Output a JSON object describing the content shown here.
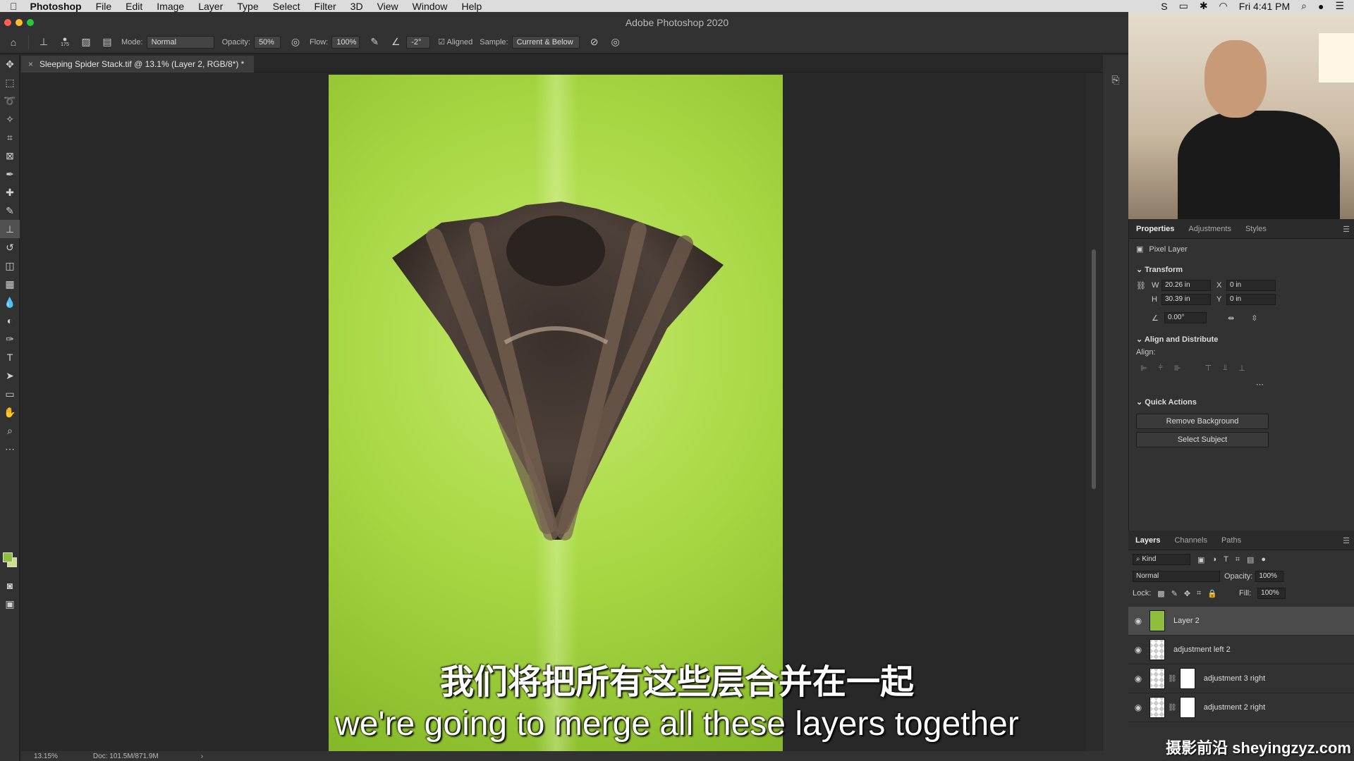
{
  "menubar": {
    "app": "Photoshop",
    "items": [
      "File",
      "Edit",
      "Image",
      "Layer",
      "Type",
      "Select",
      "Filter",
      "3D",
      "View",
      "Window",
      "Help"
    ],
    "clock": "Fri 4:41 PM"
  },
  "window": {
    "title": "Adobe Photoshop 2020"
  },
  "options": {
    "brush_size": "175",
    "mode_label": "Mode:",
    "mode_value": "Normal",
    "opacity_label": "Opacity:",
    "opacity_value": "50%",
    "flow_label": "Flow:",
    "flow_value": "100%",
    "angle_value": "-2°",
    "aligned_label": "Aligned",
    "sample_label": "Sample:",
    "sample_value": "Current & Below"
  },
  "document": {
    "tab_title": "Sleeping Spider Stack.tif @ 13.1% (Layer 2, RGB/8*) *"
  },
  "status": {
    "zoom": "13.15%",
    "doc_size": "Doc: 101.5M/871.9M"
  },
  "properties": {
    "tabs": [
      "Properties",
      "Adjustments",
      "Styles"
    ],
    "kind": "Pixel Layer",
    "transform_heading": "Transform",
    "w_label": "W",
    "w_value": "20.26 in",
    "h_label": "H",
    "h_value": "30.39 in",
    "x_label": "X",
    "x_value": "0 in",
    "y_label": "Y",
    "y_value": "0 in",
    "angle_value": "0.00°",
    "align_heading": "Align and Distribute",
    "align_label": "Align:",
    "quick_heading": "Quick Actions",
    "remove_bg": "Remove Background",
    "select_subject": "Select Subject"
  },
  "layers_panel": {
    "tabs": [
      "Layers",
      "Channels",
      "Paths"
    ],
    "kind_filter": "Kind",
    "blend_mode": "Normal",
    "opacity_label": "Opacity:",
    "opacity_value": "100%",
    "lock_label": "Lock:",
    "fill_label": "Fill:",
    "fill_value": "100%",
    "layers": [
      {
        "name": "Layer 2"
      },
      {
        "name": "adjustment left 2"
      },
      {
        "name": "adjustment 3 right"
      },
      {
        "name": "adjustment 2 right"
      }
    ]
  },
  "subtitles": {
    "chinese": "我们将把所有这些层合并在一起",
    "english": "we're going to merge all these layers together"
  },
  "watermark": "摄影前沿 sheyingzyz.com"
}
